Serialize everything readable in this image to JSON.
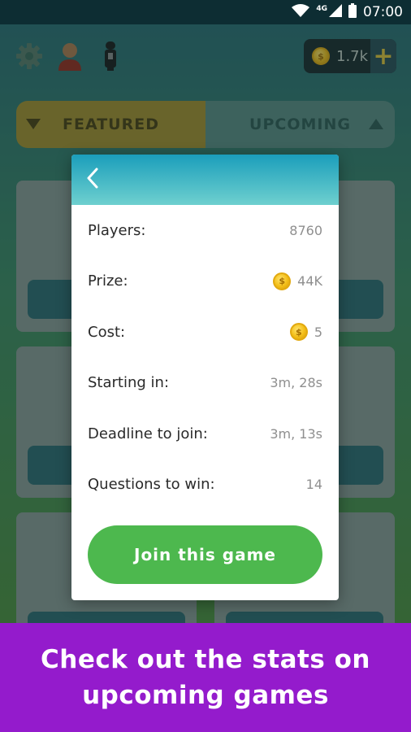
{
  "status_bar": {
    "network": "4G",
    "time": "07:00"
  },
  "top_bar": {
    "icons": [
      "gear-icon",
      "avatar-icon",
      "microphone-icon"
    ],
    "coins": "1.7k",
    "plus": "+"
  },
  "tabs": [
    {
      "label": "FEATURED"
    },
    {
      "label": "UPCOMING"
    }
  ],
  "modal": {
    "back_icon": "chevron-left-icon",
    "rows": [
      {
        "label": "Players:",
        "value": "8760",
        "coin": false
      },
      {
        "label": "Prize:",
        "value": "44K",
        "coin": true
      },
      {
        "label": "Cost:",
        "value": "5",
        "coin": true
      },
      {
        "label": "Starting in:",
        "value": "3m, 28s",
        "coin": false
      },
      {
        "label": "Deadline to join:",
        "value": "3m, 13s",
        "coin": false
      },
      {
        "label": "Questions to win:",
        "value": "14",
        "coin": false
      }
    ],
    "join_label": "Join this game"
  },
  "footer": {
    "line1": "Check out the stats on",
    "line2": "upcoming games"
  },
  "colors": {
    "footer_bg": "#941bcc",
    "join_button": "#4db84e",
    "header_gradient_start": "#1b9ebb",
    "header_gradient_end": "#6ed0cf"
  }
}
